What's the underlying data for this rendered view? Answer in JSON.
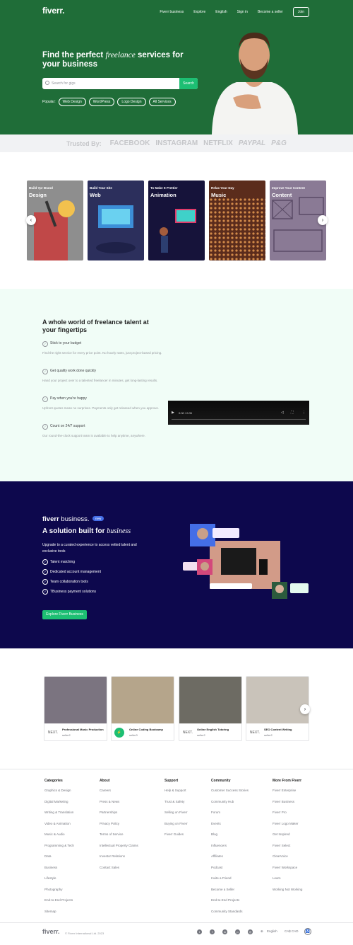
{
  "header": {
    "logo": "fiverr.",
    "nav": [
      "Fiverr business",
      "Explore",
      "English",
      "Sign in",
      "Become a seller"
    ],
    "join_label": "Join"
  },
  "hero": {
    "title_1": "Find the perfect ",
    "title_em": "freelance",
    "title_2": " services for your business",
    "search_placeholder": "Search for gigs",
    "search_button": "Search",
    "popular_label": "Popular:",
    "popular_tags": [
      "Web Design",
      "WordPress",
      "Logo Design",
      "All Services"
    ]
  },
  "trusted": {
    "label": "Trusted By:",
    "brands": [
      "FACEBOOK",
      "INSTAGRAM",
      "NETFLIX",
      "PAYPAL",
      "P&G"
    ]
  },
  "categories": [
    {
      "sub": "Build Ypr Brand",
      "name": "Design",
      "color": "#8e8e8e"
    },
    {
      "sub": "Build Your Site",
      "name": "Web",
      "color": "#2c2f5c"
    },
    {
      "sub": "To Make It Prettier",
      "name": "Animation",
      "color": "#16133a"
    },
    {
      "sub": "Relax Your Day",
      "name": "Music",
      "color": "#5b2c1c"
    },
    {
      "sub": "Improve Your Content",
      "name": "Content",
      "color": "#8a7a95"
    }
  ],
  "features": {
    "title": "A whole world of freelance talent at your fingertips",
    "items": [
      {
        "title": "Stick to your budget",
        "desc": "Find the right service for every price point. No hourly rates, just project-based pricing."
      },
      {
        "title": "Get quality work done quickly",
        "desc": "Hand your project over to a talented freelancer in minutes, get long-lasting results."
      },
      {
        "title": "Pay when you're happy",
        "desc": "Upfront quotes mean no surprises. Payments only get released when you approve."
      },
      {
        "title": "Count on 24/7 support",
        "desc": "Our round-the-clock support team is available to help anytime, anywhere."
      }
    ],
    "video_time": "0:00 / 0:05"
  },
  "business": {
    "logo_bold": "fiverr",
    "logo_light": " business.",
    "badge": "new",
    "title": "A solution built for ",
    "title_em": "business",
    "desc": "Upgrade to a curated experience to access vetted talent and exclusive tools",
    "list": [
      "Talent matching",
      "Dedicated account management",
      "Team collaboration tools",
      "TBusiness payment solutions"
    ],
    "button": "Explore Fiverr Business"
  },
  "gigs": [
    {
      "title": "Professional Music Production",
      "seller": "seller2",
      "avatar": "NEXT.",
      "color": "#7b7480"
    },
    {
      "title": "Online Coding Bootcamp",
      "seller": "seller3",
      "avatar": "⚡",
      "color": "#b5a58b"
    },
    {
      "title": "Online English Tutoring",
      "seller": "seller2",
      "avatar": "NEXT.",
      "color": "#6d6b63"
    },
    {
      "title": "SEO Content Writing",
      "seller": "seller2",
      "avatar": "NEXT.",
      "color": "#c9c3ba"
    }
  ],
  "footer": {
    "columns": [
      {
        "title": "Categories",
        "links": [
          "Graphics & Design",
          "Digital Marketing",
          "Writing & Translation",
          "Video & Animation",
          "Music & Audio",
          "Programming & Tech",
          "Data",
          "Business",
          "Lifestyle",
          "Photography",
          "End-to-End Projects",
          "Sitemap"
        ]
      },
      {
        "title": "About",
        "links": [
          "Careers",
          "Press & News",
          "Partnerships",
          "Privacy Policy",
          "Terms of Service",
          "Intellectual Property Claims",
          "Investor Relations",
          "Contact Sales"
        ]
      },
      {
        "title": "Support",
        "links": [
          "Help & Support",
          "Trust & Safety",
          "Selling on Fiverr",
          "Buying on Fiverr",
          "Fiverr Guides"
        ]
      },
      {
        "title": "Community",
        "links": [
          "Customer Success Stories",
          "Community Hub",
          "Forum",
          "Events",
          "Blog",
          "Influencers",
          "Affiliates",
          "Podcast",
          "Invite a Friend",
          "Become a Seller",
          "End-to-End Projects",
          "Community Standards"
        ]
      },
      {
        "title": "More From Fiverr",
        "links": [
          "Fiverr Enterprise",
          "Fiverr Business",
          "Fiverr Pro",
          "Fiverr Logo Maker",
          "Get Inspired",
          "Fiverr Select",
          "ClearVoice",
          "Fiverr Workspace",
          "Learn",
          "Working Not Working"
        ]
      }
    ],
    "logo": "fiverr.",
    "copyright": "© Fiverr International Ltd. 2023",
    "social": [
      "twitter-icon",
      "facebook-icon",
      "linkedin-icon",
      "pinterest-icon",
      "instagram-icon"
    ],
    "language": "English",
    "currency": "CA$ CAD"
  },
  "colors": {
    "brand_green": "#1dbf73",
    "hero_bg": "#1f6d38",
    "business_bg": "#0d084d",
    "features_bg": "#f1fdf7"
  }
}
